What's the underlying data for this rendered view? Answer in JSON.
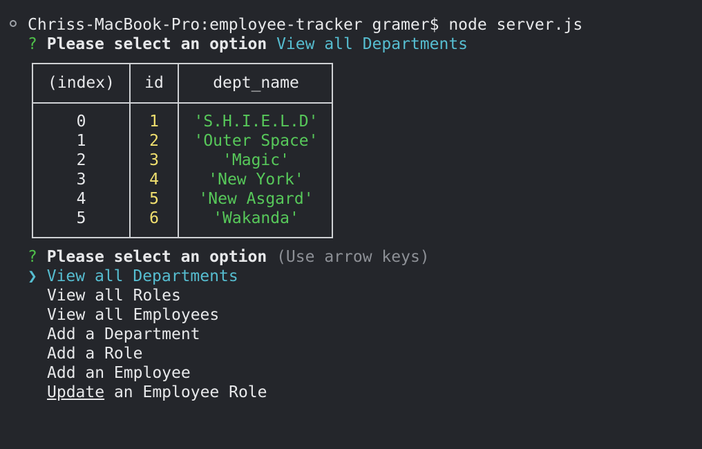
{
  "command_line": {
    "host_path": "Chriss-MacBook-Pro:employee-tracker",
    "user_prompt": "gramer$",
    "command": "node server.js"
  },
  "first_prompt": {
    "mark": "?",
    "question": "Please select an option",
    "answer": "View all Departments"
  },
  "table": {
    "headers": [
      "(index)",
      "id",
      "dept_name"
    ],
    "rows": [
      {
        "index": "0",
        "id": "1",
        "dept_name": "'S.H.I.E.L.D'"
      },
      {
        "index": "1",
        "id": "2",
        "dept_name": "'Outer Space'"
      },
      {
        "index": "2",
        "id": "3",
        "dept_name": "'Magic'"
      },
      {
        "index": "3",
        "id": "4",
        "dept_name": "'New York'"
      },
      {
        "index": "4",
        "id": "5",
        "dept_name": "'New Asgard'"
      },
      {
        "index": "5",
        "id": "6",
        "dept_name": "'Wakanda'"
      }
    ]
  },
  "second_prompt": {
    "mark": "?",
    "question": "Please select an option",
    "hint": "(Use arrow keys)",
    "pointer": "❯",
    "options": [
      "View all Departments",
      "View all Roles",
      "View all Employees",
      "Add a Department",
      "Add a Role",
      "Add an Employee"
    ],
    "last_option_underlined": "Update",
    "last_option_rest": " an Employee Role"
  }
}
